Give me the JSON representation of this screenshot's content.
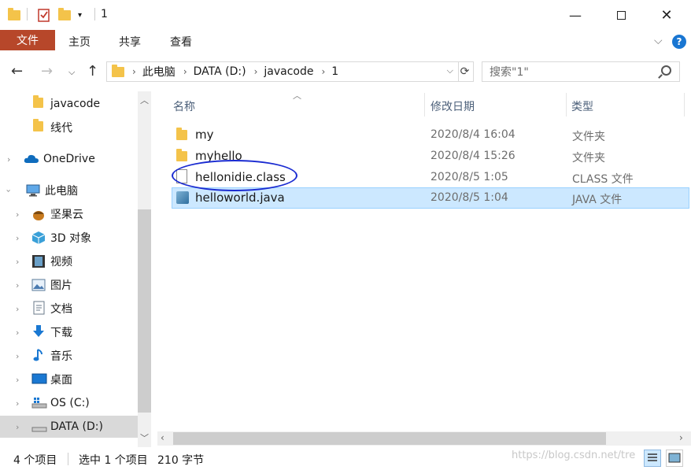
{
  "window": {
    "title": "1",
    "minimize_icon": "minimize-icon",
    "maximize_icon": "maximize-icon",
    "close_icon": "close-icon"
  },
  "ribbon": {
    "tabs": [
      {
        "label": "文件",
        "active": true
      },
      {
        "label": "主页"
      },
      {
        "label": "共享"
      },
      {
        "label": "查看"
      }
    ],
    "help": "?"
  },
  "address": {
    "segments": [
      "此电脑",
      "DATA (D:)",
      "javacode",
      "1"
    ]
  },
  "search": {
    "placeholder": "搜索\"1\""
  },
  "nav": {
    "items": [
      {
        "label": "javacode",
        "icon": "folder-icon"
      },
      {
        "label": "线代",
        "icon": "folder-icon"
      },
      {
        "label": "OneDrive",
        "icon": "cloud-icon"
      },
      {
        "label": "此电脑",
        "icon": "computer-icon"
      },
      {
        "label": "坚果云",
        "icon": "nut-icon"
      },
      {
        "label": "3D 对象",
        "icon": "cube-icon"
      },
      {
        "label": "视频",
        "icon": "video-icon"
      },
      {
        "label": "图片",
        "icon": "picture-icon"
      },
      {
        "label": "文档",
        "icon": "document-icon"
      },
      {
        "label": "下载",
        "icon": "download-icon"
      },
      {
        "label": "音乐",
        "icon": "music-icon"
      },
      {
        "label": "桌面",
        "icon": "desktop-icon"
      },
      {
        "label": "OS (C:)",
        "icon": "drive-icon"
      },
      {
        "label": "DATA (D:)",
        "icon": "drive-icon"
      }
    ]
  },
  "columns": {
    "name": "名称",
    "date": "修改日期",
    "type": "类型"
  },
  "files": [
    {
      "name": "my",
      "date": "2020/8/4 16:04",
      "type": "文件夹",
      "icon": "folder-icon"
    },
    {
      "name": "myhello",
      "date": "2020/8/4 15:26",
      "type": "文件夹",
      "icon": "folder-icon"
    },
    {
      "name": "hellonidie.class",
      "date": "2020/8/5 1:05",
      "type": "CLASS 文件",
      "icon": "file-icon"
    },
    {
      "name": "helloworld.java",
      "date": "2020/8/5 1:04",
      "type": "JAVA 文件",
      "icon": "java-file-icon"
    }
  ],
  "status": {
    "count": "4 个项目",
    "selection": "选中 1 个项目",
    "size": "210 字节"
  },
  "watermark": "https://blog.csdn.net/tre",
  "colors": {
    "file_tab": "#b7472a",
    "selection": "#cce8ff",
    "annotation": "#1a2bd1",
    "folder": "#f4c34a"
  }
}
